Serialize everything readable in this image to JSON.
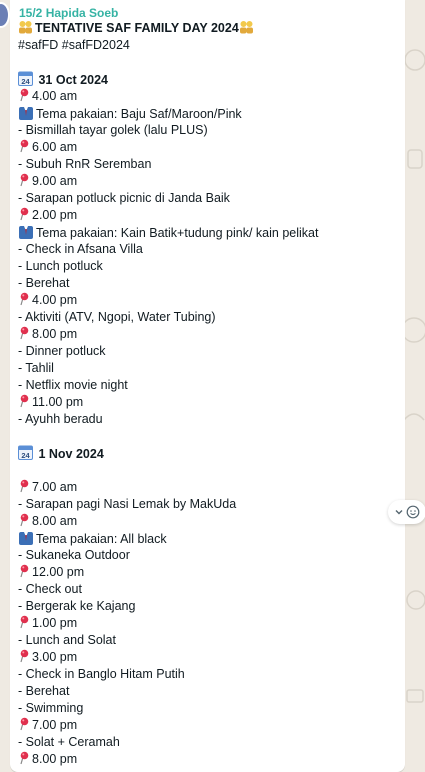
{
  "message": {
    "sender": "15/2 Hapida Soeb",
    "lines": [
      {
        "icon": "people-icon",
        "icon2": "people-icon",
        "text": "TENTATIVE SAF FAMILY DAY 2024",
        "bold": true
      },
      {
        "text": "#safFD #safFD2024"
      },
      {
        "text": ""
      },
      {
        "icon": "calendar-icon",
        "cal": "24",
        "text": " 31 Oct 2024",
        "bold": true
      },
      {
        "icon": "pin-icon",
        "text": "4.00 am"
      },
      {
        "icon": "suit-icon",
        "text": "Tema pakaian: Baju Saf/Maroon/Pink"
      },
      {
        "text": "- Bismillah tayar golek (lalu PLUS)"
      },
      {
        "icon": "pin-icon",
        "text": "6.00 am"
      },
      {
        "text": "- Subuh RnR Seremban"
      },
      {
        "icon": "pin-icon",
        "text": "9.00 am"
      },
      {
        "text": "- Sarapan potluck picnic di Janda Baik"
      },
      {
        "icon": "pin-icon",
        "text": "2.00 pm"
      },
      {
        "icon": "suit-icon",
        "text": "Tema pakaian: Kain Batik+tudung pink/ kain pelikat"
      },
      {
        "text": "- Check in Afsana Villa"
      },
      {
        "text": "- Lunch potluck"
      },
      {
        "text": "- Berehat"
      },
      {
        "icon": "pin-icon",
        "text": "4.00 pm"
      },
      {
        "text": "- Aktiviti (ATV, Ngopi, Water Tubing)"
      },
      {
        "icon": "pin-icon",
        "text": "8.00 pm"
      },
      {
        "text": "- Dinner potluck"
      },
      {
        "text": "- Tahlil"
      },
      {
        "text": "- Netflix movie night"
      },
      {
        "icon": "pin-icon",
        "text": "11.00 pm"
      },
      {
        "text": "- Ayuhh beradu"
      },
      {
        "text": ""
      },
      {
        "icon": "calendar-icon",
        "cal": "24",
        "text": " 1 Nov 2024",
        "bold": true
      },
      {
        "text": ""
      },
      {
        "icon": "pin-icon",
        "text": "7.00 am"
      },
      {
        "text": "- Sarapan pagi Nasi Lemak by MakUda"
      },
      {
        "icon": "pin-icon",
        "text": "8.00 am"
      },
      {
        "icon": "suit-icon",
        "text": "Tema pakaian: All black"
      },
      {
        "text": "- Sukaneka Outdoor"
      },
      {
        "icon": "pin-icon",
        "text": "12.00 pm"
      },
      {
        "text": "- Check out"
      },
      {
        "text": "- Bergerak ke Kajang"
      },
      {
        "icon": "pin-icon",
        "text": "1.00 pm"
      },
      {
        "text": "- Lunch and Solat"
      },
      {
        "icon": "pin-icon",
        "text": "3.00 pm"
      },
      {
        "text": "- Check in Banglo Hitam Putih"
      },
      {
        "text": "- Berehat"
      },
      {
        "text": "- Swimming"
      },
      {
        "icon": "pin-icon",
        "text": "7.00 pm"
      },
      {
        "text": "- Solat + Ceramah"
      },
      {
        "icon": "pin-icon",
        "text": "8.00 pm"
      }
    ]
  },
  "colors": {
    "chat_bg": "#efeae2",
    "sender": "#36b3a4",
    "pin": "#e0304e",
    "suit": "#3b6fb6",
    "calendar": "#5b8fd6"
  },
  "icons": {
    "react": "chevron-down-icon",
    "react2": "emoji-icon"
  }
}
